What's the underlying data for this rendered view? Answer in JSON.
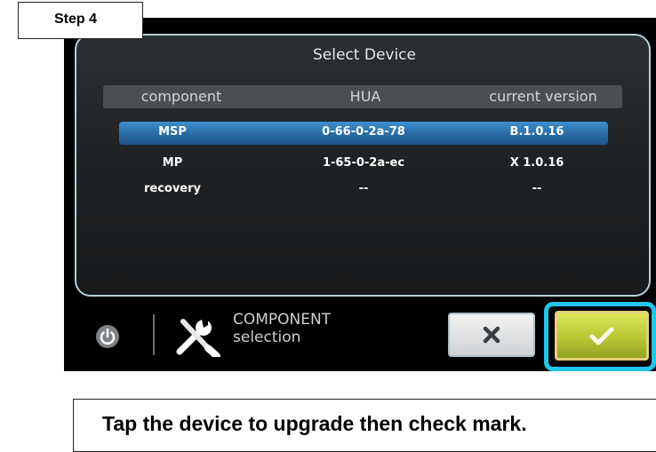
{
  "step_label": "Step 4",
  "dialog": {
    "title": "Select Device",
    "columns": [
      "component",
      "HUA",
      "current version"
    ],
    "rows": [
      {
        "component": "MSP",
        "hua": "0-66-0-2a-78",
        "version": "B.1.0.16",
        "selected": true
      },
      {
        "component": "MP",
        "hua": "1-65-0-2a-ec",
        "version": "X 1.0.16",
        "selected": false
      },
      {
        "component": "recovery",
        "hua": "--",
        "version": "--",
        "selected": false
      }
    ]
  },
  "bottom_bar": {
    "power_icon": "power-icon",
    "tools_icon": "wrench-screwdriver-icon",
    "component_line1": "COMPONENT",
    "component_line2": "selection",
    "cancel_icon": "close-icon",
    "confirm_icon": "checkmark-icon"
  },
  "instruction": "Tap the device to upgrade then check mark.",
  "colors": {
    "selected_row": "#2b6ea8",
    "confirm_button": "#b9c733",
    "highlight": "#1ec6f0"
  }
}
